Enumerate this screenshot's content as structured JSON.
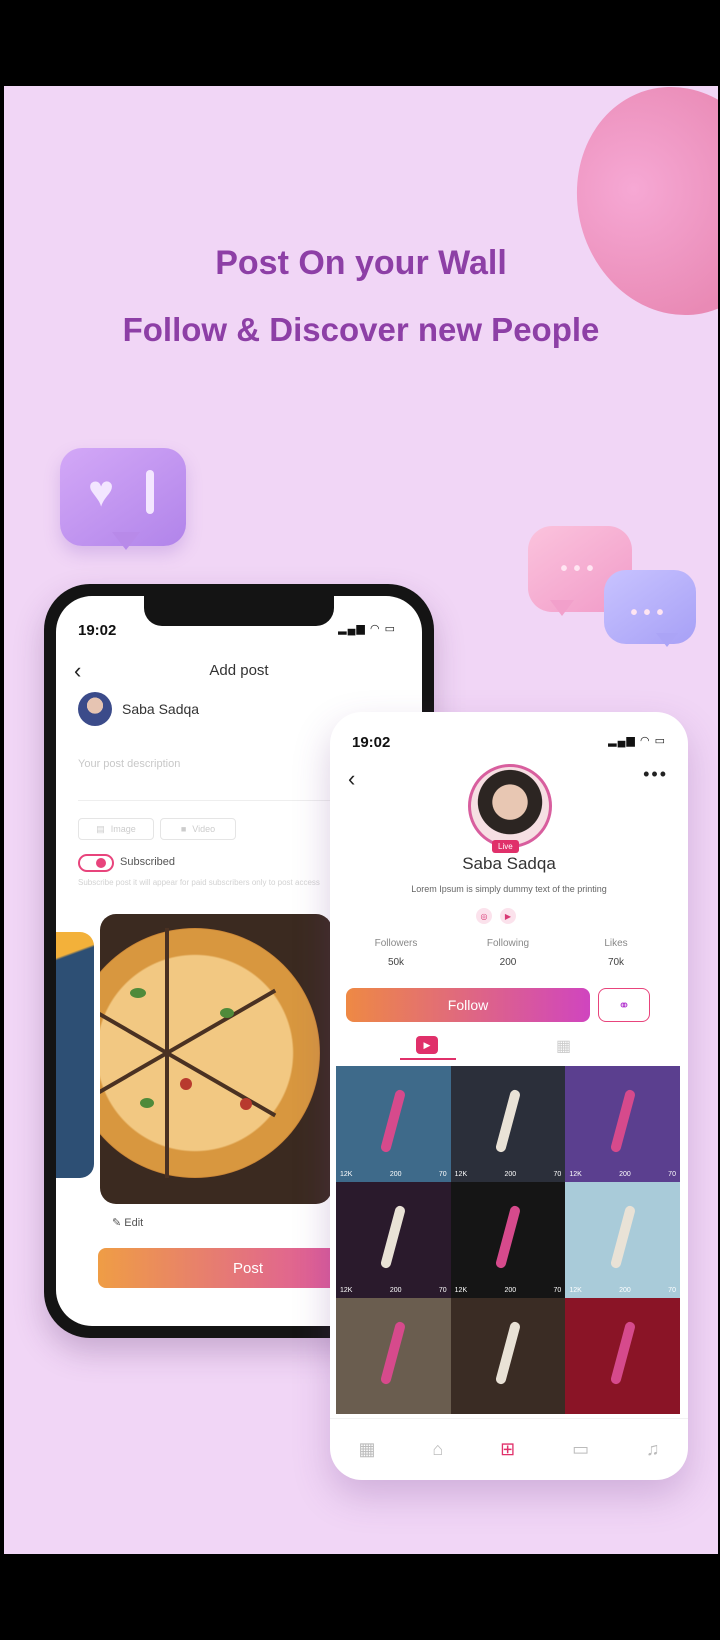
{
  "headline": {
    "line1": "Post On your Wall",
    "line2": "Follow & Discover new People"
  },
  "add_post_phone": {
    "time": "19:02",
    "title": "Add post",
    "user_name": "Saba Sadqa",
    "description_placeholder": "Your post description",
    "image_label": "Image",
    "video_label": "Video",
    "toggle_label": "Subscribed",
    "toggle_hint": "Subscribe post it will appear for paid subscribers only to post access",
    "edit_label": "Edit",
    "post_button": "Post"
  },
  "profile_phone": {
    "time": "19:02",
    "name": "Saba Sadqa",
    "live_badge": "Live",
    "bio": "Lorem Ipsum is simply dummy text of the printing",
    "stats": [
      {
        "label": "Followers",
        "value": "50k"
      },
      {
        "label": "Following",
        "value": "200"
      },
      {
        "label": "Likes",
        "value": "70k"
      }
    ],
    "follow_button": "Follow",
    "videos": [
      {
        "views": "12K",
        "comments": "200",
        "likes": "70",
        "color": "#3e6a8a"
      },
      {
        "views": "12K",
        "comments": "200",
        "likes": "70",
        "color": "#2b2f3a"
      },
      {
        "views": "12K",
        "comments": "200",
        "likes": "70",
        "color": "#5b3f8f"
      },
      {
        "views": "12K",
        "comments": "200",
        "likes": "70",
        "color": "#2a1a2c"
      },
      {
        "views": "12K",
        "comments": "200",
        "likes": "70",
        "color": "#151515"
      },
      {
        "views": "12K",
        "comments": "200",
        "likes": "70",
        "color": "#a9cbd9"
      },
      {
        "views": "",
        "comments": "",
        "likes": "",
        "color": "#6a5d4f"
      },
      {
        "views": "",
        "comments": "",
        "likes": "",
        "color": "#3a2c24"
      },
      {
        "views": "",
        "comments": "",
        "likes": "",
        "color": "#8a1426"
      }
    ]
  },
  "colors": {
    "background": "#f1d6f6",
    "headline": "#8d3fa6",
    "accent": "#e0306a"
  }
}
